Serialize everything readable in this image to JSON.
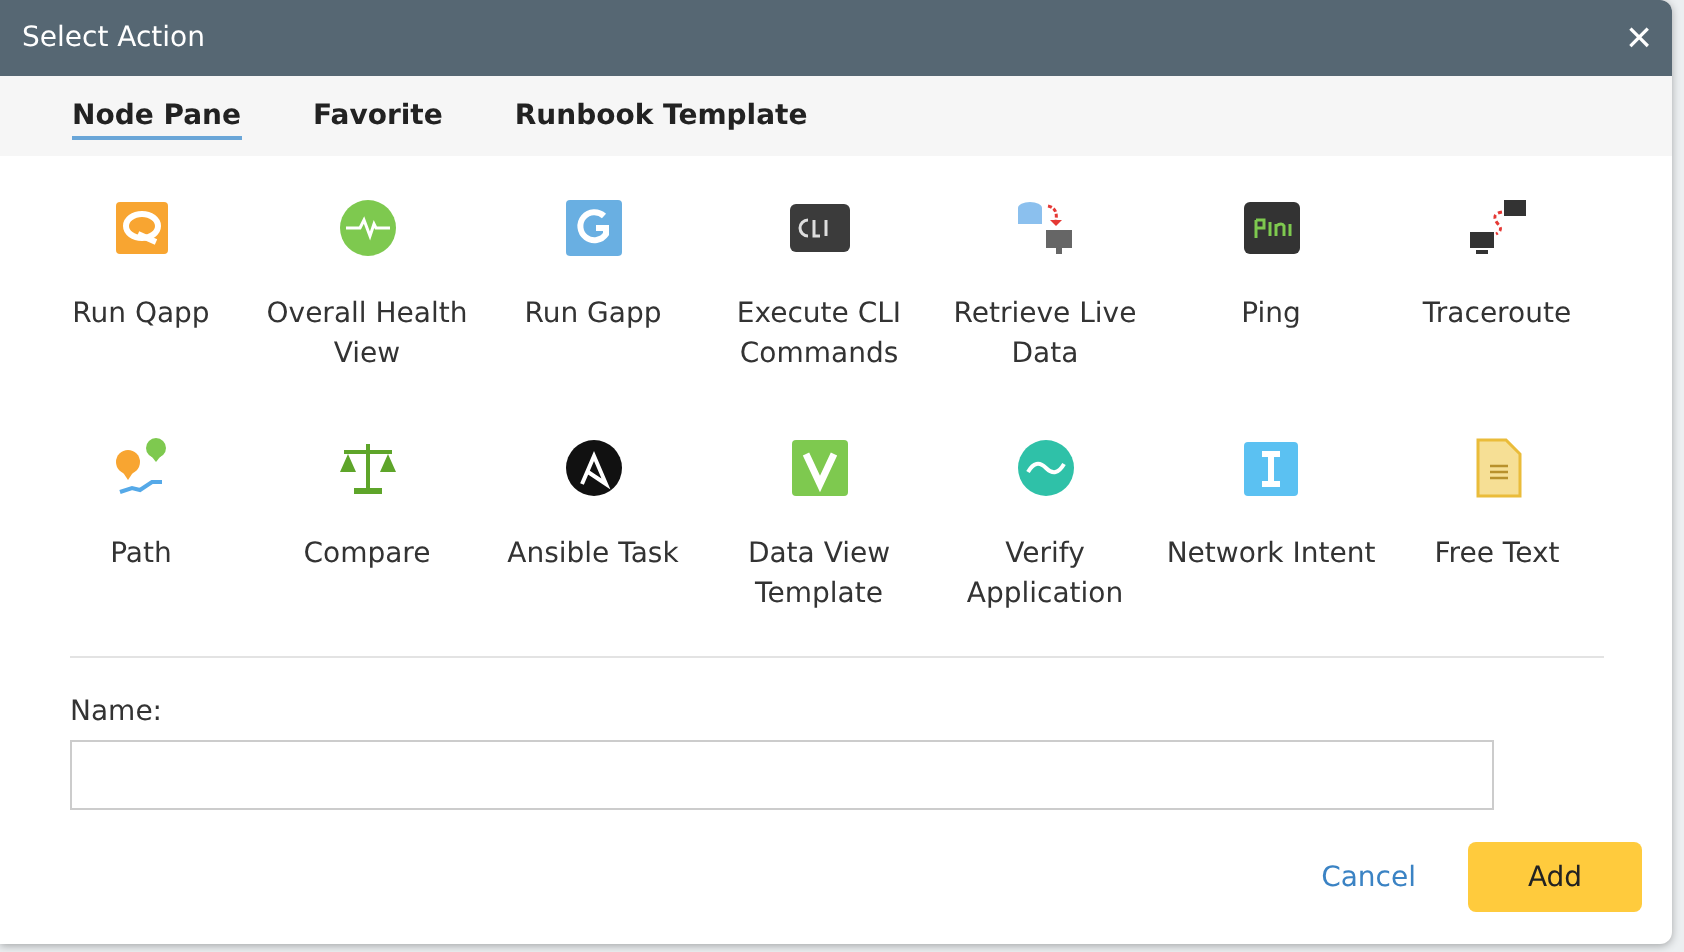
{
  "window": {
    "title": "Select Action",
    "close": "×"
  },
  "tabs": [
    {
      "label": "Node Pane",
      "selected": true
    },
    {
      "label": "Favorite",
      "selected": false
    },
    {
      "label": "Runbook Template",
      "selected": false
    }
  ],
  "actions": [
    {
      "label": "Run Qapp"
    },
    {
      "label": "Overall Health View"
    },
    {
      "label": "Run Gapp"
    },
    {
      "label": "Execute CLI Commands"
    },
    {
      "label": "Retrieve Live Data"
    },
    {
      "label": "Ping"
    },
    {
      "label": "Traceroute"
    },
    {
      "label": "Path"
    },
    {
      "label": "Compare"
    },
    {
      "label": "Ansible Task"
    },
    {
      "label": "Data View Template"
    },
    {
      "label": "Verify Application"
    },
    {
      "label": "Network Intent"
    },
    {
      "label": "Free Text"
    }
  ],
  "name_field": {
    "label": "Name:"
  },
  "buttons": {
    "cancel": "Cancel",
    "add": "Add"
  }
}
